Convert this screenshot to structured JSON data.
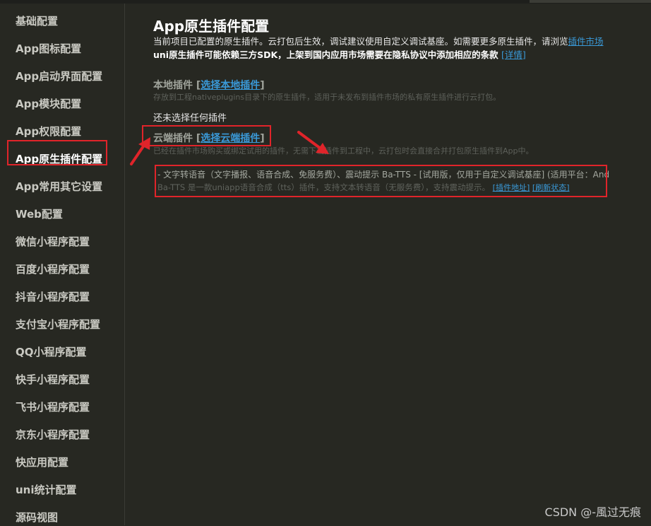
{
  "sidebar": {
    "items": [
      {
        "label": "基础配置"
      },
      {
        "label": "App图标配置"
      },
      {
        "label": "App启动界面配置"
      },
      {
        "label": "App模块配置"
      },
      {
        "label": "App权限配置"
      },
      {
        "label": "App原生插件配置",
        "active": true
      },
      {
        "label": "App常用其它设置"
      },
      {
        "label": "Web配置"
      },
      {
        "label": "微信小程序配置"
      },
      {
        "label": "百度小程序配置"
      },
      {
        "label": "抖音小程序配置"
      },
      {
        "label": "支付宝小程序配置"
      },
      {
        "label": "QQ小程序配置"
      },
      {
        "label": "快手小程序配置"
      },
      {
        "label": "飞书小程序配置"
      },
      {
        "label": "京东小程序配置"
      },
      {
        "label": "快应用配置"
      },
      {
        "label": "uni统计配置"
      },
      {
        "label": "源码视图"
      }
    ]
  },
  "main": {
    "title": "App原生插件配置",
    "desc1": "当前项目已配置的原生插件。云打包后生效，调试建议使用自定义调试基座。如需要更多原生插件，请浏览",
    "desc1_link": "插件市场",
    "desc2": "uni原生插件可能依赖三方SDK，上架到国内应用市场需要在隐私协议中添加相应的条款",
    "desc2_link": "[详情]",
    "local": {
      "title": "本地插件 [",
      "link": "选择本地插件",
      "close": "]",
      "desc": "存放到工程nativeplugins目录下的原生插件，适用于未发布到插件市场的私有原生插件进行云打包。",
      "empty": "还未选择任何插件"
    },
    "cloud": {
      "title": "云端插件 [",
      "link": "选择云端插件",
      "close": "]",
      "desc": "已经在插件市场购买或绑定试用的插件，无需下载插件到工程中，云打包时会直接合并打包原生插件到App中。",
      "plugin_line1": "- 文字转语音（文字播报、语音合成、免服务费）、震动提示 Ba-TTS - [试用版，仅用于自定义调试基座] (适用平台：And",
      "plugin_line2": "Ba-TTS 是一款uniapp语音合成（tts）插件，支持文本转语音（无服务费），支持震动提示。",
      "plugin_link1": "[插件地址]",
      "plugin_link2": "[刷新状态]"
    }
  },
  "watermark": "CSDN @-風过无痕",
  "colors": {
    "background": "#272822",
    "accent_link": "#3a9ad9",
    "annotation_red": "#e0242a"
  }
}
